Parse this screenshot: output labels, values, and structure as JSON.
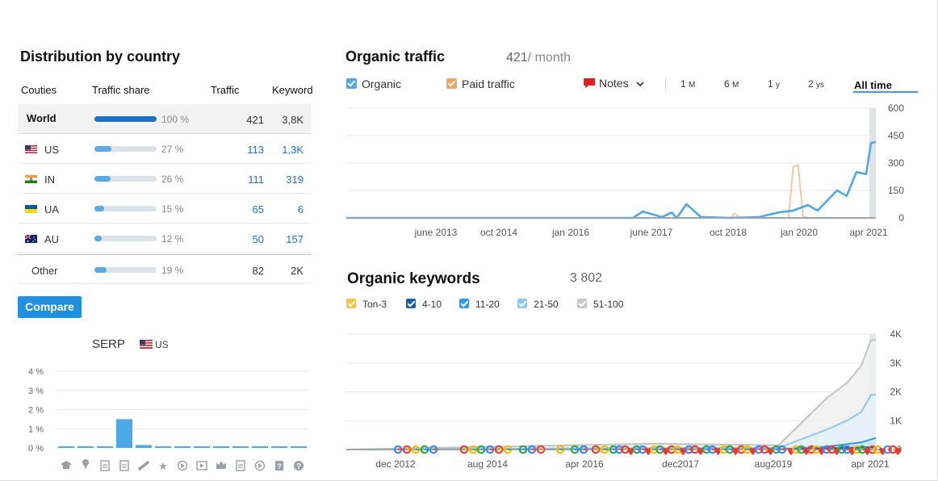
{
  "distribution": {
    "title": "Distribution by country",
    "headers": {
      "country": "Couties",
      "share": "Traffic share",
      "traffic": "Traffic",
      "keyword": "Keyword"
    },
    "rows": [
      {
        "name": "World",
        "flag": "",
        "share": 100,
        "share_label": "100 %",
        "traffic": "421",
        "keywords": "3,8K"
      },
      {
        "name": "US",
        "flag": "us-flag-icon",
        "share": 27,
        "share_label": "27 %",
        "traffic": "113",
        "keywords": "1,3K"
      },
      {
        "name": "IN",
        "flag": "in-flag-icon",
        "share": 26,
        "share_label": "26 %",
        "traffic": "111",
        "keywords": "319"
      },
      {
        "name": "UA",
        "flag": "ua-flag-icon",
        "share": 15,
        "share_label": "15 %",
        "traffic": "65",
        "keywords": "6"
      },
      {
        "name": "AU",
        "flag": "au-flag-icon",
        "share": 12,
        "share_label": "12 %",
        "traffic": "50",
        "keywords": "157"
      },
      {
        "name": "Other",
        "flag": "",
        "share": 19,
        "share_label": "19 %",
        "traffic": "82",
        "keywords": "2K"
      }
    ],
    "compare_label": "Compare"
  },
  "serp": {
    "title": "SERP",
    "country": "US",
    "icons": [
      "graduation-cap-icon",
      "map-pin-icon",
      "document-icon",
      "image-icon",
      "link-icon",
      "star-icon",
      "play-icon",
      "video-icon",
      "crown-icon",
      "photo-icon",
      "play-circle-icon",
      "question-box-icon",
      "help-circle-icon"
    ]
  },
  "organic_traffic": {
    "title": "Organic traffic",
    "value": "421",
    "unit": "month",
    "legend": {
      "organic": "Organic",
      "paid": "Paid traffic"
    },
    "notes_label": "Notes",
    "ranges": [
      {
        "value": "1",
        "unit": "M"
      },
      {
        "value": "6",
        "unit": "M"
      },
      {
        "value": "1",
        "unit": "y"
      },
      {
        "value": "2",
        "unit": "ys"
      }
    ],
    "range_all": "All time",
    "colors": {
      "organic": "#4fa8e8",
      "paid": "#f4a261"
    }
  },
  "organic_keywords": {
    "title": "Organic keywords",
    "value": "3 802",
    "legend": [
      "Ton-3",
      "4-10",
      "11-20",
      "21-50",
      "51-100"
    ],
    "colors": [
      "#f5c242",
      "#1b5fa6",
      "#2d9be6",
      "#8fc8ef",
      "#c8c8c8"
    ]
  },
  "chart_data": [
    {
      "type": "bar",
      "title": "SERP",
      "categories": [
        "1",
        "2",
        "3",
        "4",
        "5",
        "6",
        "7",
        "8",
        "9",
        "10",
        "11",
        "12",
        "13"
      ],
      "values": [
        0.05,
        0.05,
        0.05,
        1.5,
        0.15,
        0.05,
        0.05,
        0.05,
        0.05,
        0.05,
        0.05,
        0.05,
        0.05
      ],
      "y_ticks": [
        "4 %",
        "3 %",
        "2 %",
        "1 %",
        "0 %"
      ],
      "ylim": [
        0,
        4
      ]
    },
    {
      "type": "line",
      "title": "Organic traffic",
      "x_ticks": [
        "june 2013",
        "oct  2014",
        "jan 2016",
        "june 2017",
        "oct 2018",
        "jan 2020",
        "apr  2021"
      ],
      "y_ticks": [
        "600",
        "450",
        "300",
        "150",
        "0"
      ],
      "ylim": [
        0,
        600
      ],
      "series": [
        {
          "name": "Organic",
          "x": [
            "2012-03",
            "2017-02",
            "2017-04",
            "2017-08",
            "2017-10",
            "2017-11",
            "2018-01",
            "2018-04",
            "2018-10",
            "2019-04",
            "2019-08",
            "2019-11",
            "2020-02",
            "2020-04",
            "2020-08",
            "2020-10",
            "2020-12",
            "2021-02",
            "2021-03",
            "2021-04"
          ],
          "y": [
            0,
            0,
            35,
            5,
            30,
            0,
            75,
            5,
            0,
            5,
            30,
            40,
            70,
            40,
            150,
            120,
            250,
            240,
            410,
            415
          ]
        },
        {
          "name": "Paid traffic",
          "x": [
            "2012-03",
            "2018-10",
            "2018-11",
            "2018-12",
            "2019-10",
            "2019-11",
            "2019-12",
            "2020-01",
            "2020-02",
            "2021-04"
          ],
          "y": [
            0,
            0,
            25,
            0,
            0,
            280,
            290,
            10,
            0,
            0
          ]
        }
      ]
    },
    {
      "type": "area",
      "title": "Organic keywords",
      "x_ticks": [
        "dec 2012",
        "aug 2014",
        "apr  2016",
        "dec2017",
        "aug2019",
        "apr 2021"
      ],
      "y_ticks": [
        "4K",
        "3K",
        "2K",
        "1K",
        "0"
      ],
      "ylim": [
        0,
        4000
      ],
      "series": [
        {
          "name": "51-100",
          "x": [
            "2012-03",
            "2017-06",
            "2019-08",
            "2020-06",
            "2020-10",
            "2021-01",
            "2021-03",
            "2021-04"
          ],
          "y": [
            0,
            200,
            150,
            1800,
            2300,
            2900,
            3800,
            3800
          ]
        },
        {
          "name": "21-50",
          "x": [
            "2012-03",
            "2017-06",
            "2019-08",
            "2020-06",
            "2020-10",
            "2021-01",
            "2021-03",
            "2021-04"
          ],
          "y": [
            0,
            50,
            60,
            700,
            1000,
            1300,
            1900,
            1900
          ]
        },
        {
          "name": "11-20",
          "x": [
            "2012-03",
            "2019-08",
            "2020-06",
            "2021-01",
            "2021-04"
          ],
          "y": [
            0,
            10,
            100,
            250,
            400
          ]
        },
        {
          "name": "4-10",
          "x": [
            "2012-03",
            "2019-08",
            "2021-04"
          ],
          "y": [
            0,
            0,
            80
          ]
        }
      ]
    }
  ]
}
